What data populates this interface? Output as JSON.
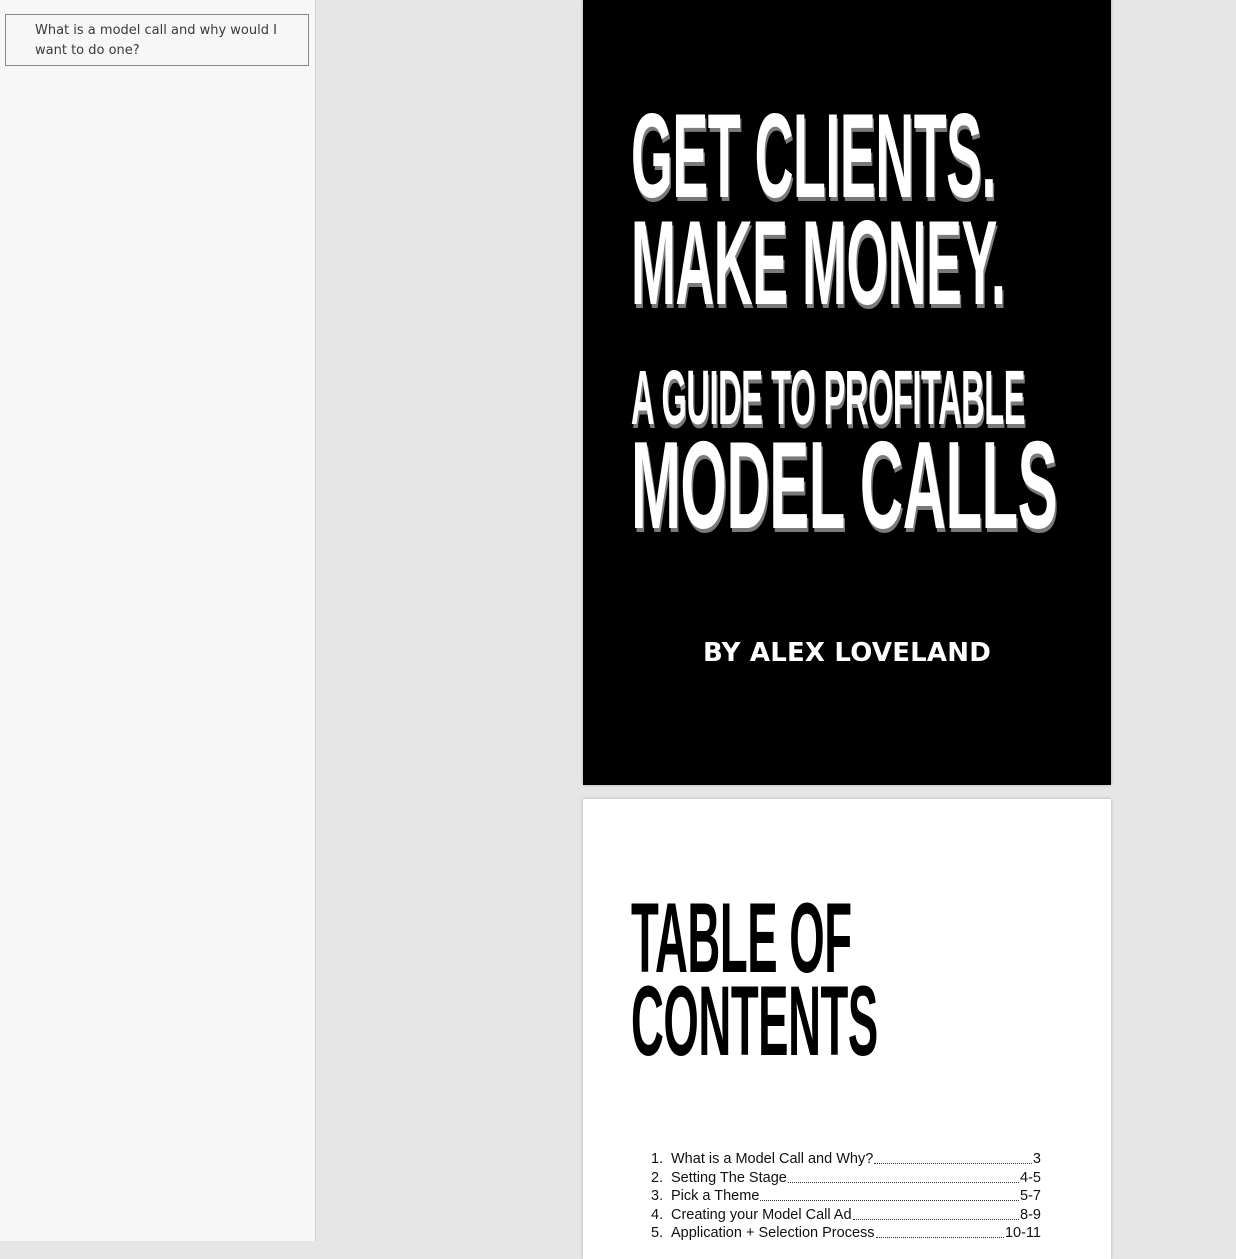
{
  "outline": {
    "items": [
      {
        "label": "What is a model call and why would I want to do one?"
      }
    ]
  },
  "cover": {
    "line1": "GET CLIENTS.",
    "line2": "MAKE MONEY.",
    "line3": "A GUIDE TO PROFITABLE",
    "line4": "MODEL CALLS",
    "author": "BY ALEX LOVELAND"
  },
  "toc": {
    "heading_line1": "TABLE OF",
    "heading_line2": "CONTENTS",
    "entries": [
      {
        "num": "1.",
        "title": "What is a Model Call and Why? ",
        "page": "3"
      },
      {
        "num": "2.",
        "title": "Setting The Stage",
        "page": "4-5"
      },
      {
        "num": "3.",
        "title": "Pick a Theme",
        "page": "5-7"
      },
      {
        "num": "4.",
        "title": "Creating your Model Call Ad",
        "page": "8-9"
      },
      {
        "num": "5.",
        "title": "Application + Selection Process",
        "page": "10-11"
      }
    ]
  },
  "colors": {
    "cover_bg": "#000000",
    "cover_text": "#ffffff",
    "text_shadow": "#7a7a7a",
    "viewer_bg": "#e6e6e6",
    "sidebar_bg": "#f7f7f7"
  }
}
